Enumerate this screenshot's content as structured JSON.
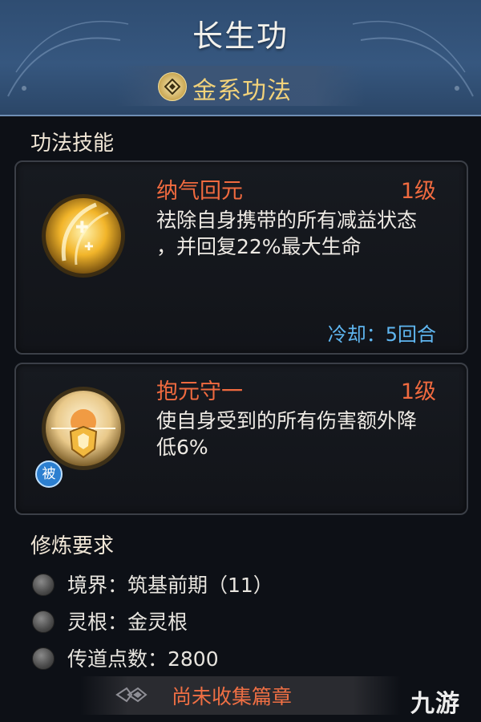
{
  "header": {
    "title": "长生功",
    "element_label": "金系功法"
  },
  "skills_section": {
    "title": "功法技能",
    "skills": [
      {
        "name": "纳气回元",
        "level": "1级",
        "description": "祛除自身携带的所有减益状态，并回复22%最大生命",
        "desc_line1": "祛除自身携带的所有减益状态",
        "desc_line2": "，并回复22%最大生命",
        "cooldown": "冷却：5回合",
        "passive": false
      },
      {
        "name": "抱元守一",
        "level": "1级",
        "description": "使自身受到的所有伤害额外降低6%",
        "desc_line1": "使自身受到的所有伤害额外降",
        "desc_line2": "低6%",
        "passive_badge": "被",
        "passive": true
      }
    ]
  },
  "requirements_section": {
    "title": "修炼要求",
    "items": [
      {
        "text": "境界：筑基前期（11）"
      },
      {
        "text": "灵根：金灵根"
      },
      {
        "text": "传道点数：2800"
      }
    ]
  },
  "footer": {
    "status": "尚未收集篇章"
  },
  "watermark": "九游",
  "colors": {
    "header_bg": "#36577f",
    "skill_name": "#f06a3f",
    "cooldown": "#5fb6f0",
    "element_label": "#f2d27a",
    "footer_status": "#ef6f44"
  }
}
